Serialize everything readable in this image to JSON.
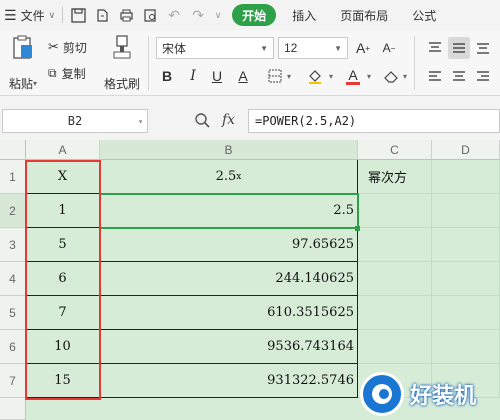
{
  "menubar": {
    "file_label": "文件",
    "tabs": [
      {
        "label": "开始",
        "active": true
      },
      {
        "label": "插入",
        "active": false
      },
      {
        "label": "页面布局",
        "active": false
      },
      {
        "label": "公式",
        "active": false
      }
    ]
  },
  "ribbon": {
    "cut_label": "剪切",
    "copy_label": "复制",
    "paste_label": "粘贴",
    "format_painter_label": "格式刷",
    "font_name": "宋体",
    "font_size": "12"
  },
  "formula_bar": {
    "name_box": "B2",
    "fx_label": "fx",
    "formula": "=POWER(2.5,A2)"
  },
  "sheet": {
    "columns": [
      "A",
      "B",
      "C",
      "D"
    ],
    "rows": [
      "1",
      "2",
      "3",
      "4",
      "5",
      "6",
      "7"
    ],
    "header_x": "X",
    "header_b": "2.5",
    "header_b_sup": "x",
    "c1": "幂次方",
    "a_values": [
      "1",
      "5",
      "6",
      "7",
      "10",
      "15"
    ],
    "b_values": [
      "2.5",
      "97.65625",
      "244.140625",
      "610.3515625",
      "9536.743164",
      "931322.5746"
    ]
  },
  "watermark": {
    "text": "好装机"
  },
  "colors": {
    "accent": "#2fa04a",
    "highlight": "#e53935",
    "cell_bg": "#d6ecd7"
  }
}
